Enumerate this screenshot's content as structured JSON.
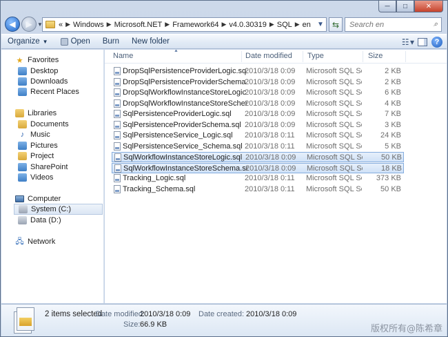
{
  "window": {
    "controls": {
      "minimize": "─",
      "maximize": "□",
      "close": "✕"
    }
  },
  "address": {
    "lead": "«",
    "crumbs": [
      "Windows",
      "Microsoft.NET",
      "Framework64",
      "v4.0.30319",
      "SQL",
      "en"
    ],
    "search_placeholder": "Search en"
  },
  "toolbar": {
    "organize": "Organize",
    "open": "Open",
    "burn": "Burn",
    "new_folder": "New folder"
  },
  "nav": {
    "favorites": {
      "header": "Favorites",
      "items": [
        "Desktop",
        "Downloads",
        "Recent Places"
      ]
    },
    "libraries": {
      "header": "Libraries",
      "items": [
        "Documents",
        "Music",
        "Pictures",
        "Project",
        "SharePoint",
        "Videos"
      ]
    },
    "computer": {
      "header": "Computer",
      "items": [
        "System (C:)",
        "Data (D:)"
      ]
    },
    "network": {
      "header": "Network"
    }
  },
  "columns": {
    "name": "Name",
    "date": "Date modified",
    "type": "Type",
    "size": "Size"
  },
  "files": [
    {
      "name": "DropSqlPersistenceProviderLogic.sql",
      "date": "2010/3/18 0:09",
      "type": "Microsoft SQL Ser...",
      "size": "2 KB",
      "selected": false
    },
    {
      "name": "DropSqlPersistenceProviderSchema.sql",
      "date": "2010/3/18 0:09",
      "type": "Microsoft SQL Ser...",
      "size": "2 KB",
      "selected": false
    },
    {
      "name": "DropSqlWorkflowInstanceStoreLogic.sql",
      "date": "2010/3/18 0:09",
      "type": "Microsoft SQL Ser...",
      "size": "6 KB",
      "selected": false
    },
    {
      "name": "DropSqlWorkflowInstanceStoreSchema.sql",
      "date": "2010/3/18 0:09",
      "type": "Microsoft SQL Ser...",
      "size": "4 KB",
      "selected": false
    },
    {
      "name": "SqlPersistenceProviderLogic.sql",
      "date": "2010/3/18 0:09",
      "type": "Microsoft SQL Ser...",
      "size": "7 KB",
      "selected": false
    },
    {
      "name": "SqlPersistenceProviderSchema.sql",
      "date": "2010/3/18 0:09",
      "type": "Microsoft SQL Ser...",
      "size": "3 KB",
      "selected": false
    },
    {
      "name": "SqlPersistenceService_Logic.sql",
      "date": "2010/3/18 0:11",
      "type": "Microsoft SQL Ser...",
      "size": "24 KB",
      "selected": false
    },
    {
      "name": "SqlPersistenceService_Schema.sql",
      "date": "2010/3/18 0:11",
      "type": "Microsoft SQL Ser...",
      "size": "5 KB",
      "selected": false
    },
    {
      "name": "SqlWorkflowInstanceStoreLogic.sql",
      "date": "2010/3/18 0:09",
      "type": "Microsoft SQL Ser...",
      "size": "50 KB",
      "selected": true
    },
    {
      "name": "SqlWorkflowInstanceStoreSchema.sql",
      "date": "2010/3/18 0:09",
      "type": "Microsoft SQL Ser...",
      "size": "18 KB",
      "selected": true
    },
    {
      "name": "Tracking_Logic.sql",
      "date": "2010/3/18 0:11",
      "type": "Microsoft SQL Ser...",
      "size": "373 KB",
      "selected": false
    },
    {
      "name": "Tracking_Schema.sql",
      "date": "2010/3/18 0:11",
      "type": "Microsoft SQL Ser...",
      "size": "50 KB",
      "selected": false
    }
  ],
  "details": {
    "selected": "2 items selected",
    "date_modified_label": "Date modified:",
    "date_modified": "2010/3/18 0:09",
    "date_created_label": "Date created:",
    "date_created": "2010/3/18 0:09",
    "size_label": "Size:",
    "size": "66.9 KB"
  },
  "watermark": "版权所有@陈希章"
}
